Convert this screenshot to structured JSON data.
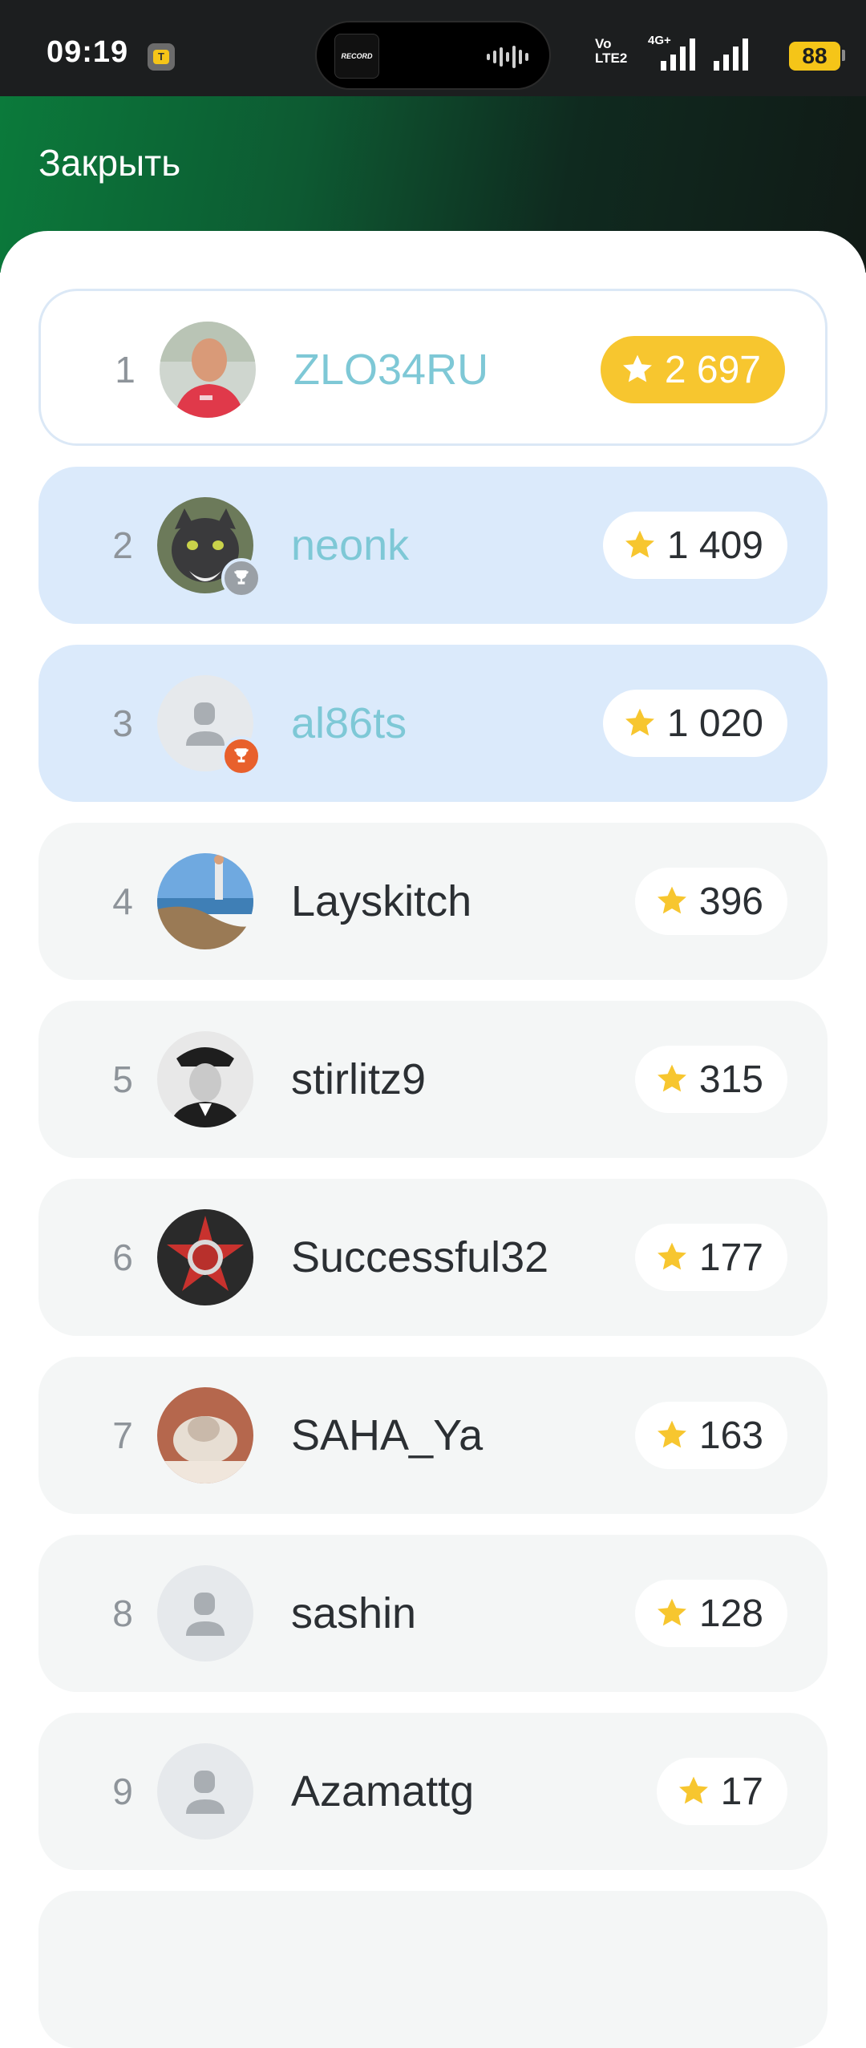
{
  "status": {
    "time": "09:19",
    "volte_top": "Vo",
    "volte_bottom": "LTE2",
    "network": "4G+",
    "battery": "88",
    "island_label": "RECORD"
  },
  "header": {
    "close_label": "Закрыть"
  },
  "colors": {
    "accent_name": "#7ec8d6",
    "gold": "#f7c62f",
    "highlight": "#dbeafb",
    "silver_badge": "#9aa0a6",
    "bronze_badge": "#e8602c"
  },
  "leaderboard": [
    {
      "rank": "1",
      "name": "ZLO34RU",
      "score": "2 697",
      "avatar": "photo-man-red-shirt"
    },
    {
      "rank": "2",
      "name": "neonk",
      "score": "1 409",
      "avatar": "photo-cat",
      "badge": "silver-trophy"
    },
    {
      "rank": "3",
      "name": "al86ts",
      "score": "1 020",
      "avatar": "placeholder",
      "badge": "bronze-trophy"
    },
    {
      "rank": "4",
      "name": "Layskitch",
      "score": "396",
      "avatar": "photo-coast"
    },
    {
      "rank": "5",
      "name": "stirlitz9",
      "score": "315",
      "avatar": "photo-officer"
    },
    {
      "rank": "6",
      "name": "Successful32",
      "score": "177",
      "avatar": "photo-order-star"
    },
    {
      "rank": "7",
      "name": "SAHA_Ya",
      "score": "163",
      "avatar": "photo-cat-blanket"
    },
    {
      "rank": "8",
      "name": "sashin",
      "score": "128",
      "avatar": "placeholder"
    },
    {
      "rank": "9",
      "name": "Azamattg",
      "score": "17",
      "avatar": "placeholder"
    }
  ]
}
